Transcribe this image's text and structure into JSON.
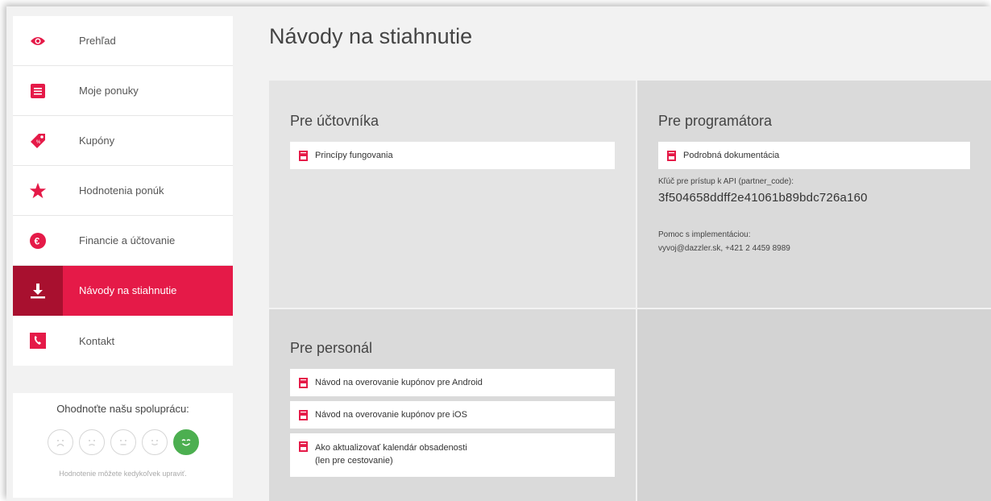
{
  "sidebar": {
    "items": [
      {
        "label": "Prehľad",
        "icon": "eye-icon"
      },
      {
        "label": "Moje ponuky",
        "icon": "list-icon"
      },
      {
        "label": "Kupóny",
        "icon": "tag-icon"
      },
      {
        "label": "Hodnotenia ponúk",
        "icon": "star-icon"
      },
      {
        "label": "Financie a účtovanie",
        "icon": "euro-icon"
      },
      {
        "label": "Návody na stiahnutie",
        "icon": "download-icon",
        "active": true
      },
      {
        "label": "Kontakt",
        "icon": "phone-book-icon"
      }
    ],
    "rating": {
      "title": "Ohodnoťte našu spoluprácu:",
      "note": "Hodnotenie môžete kedykoľvek upraviť.",
      "selected_face": 5
    }
  },
  "page": {
    "title": "Návody na stiahnutie"
  },
  "sections": {
    "accountant": {
      "title": "Pre účtovníka",
      "links": [
        "Princípy fungovania"
      ]
    },
    "programmer": {
      "title": "Pre programátora",
      "links": [
        "Podrobná dokumentácia"
      ],
      "api_label": "Kľúč pre prístup k API (partner_code):",
      "api_key": "3f504658ddff2e41061b89bdc726a160",
      "help_label": "Pomoc s implementáciou:",
      "help_contact": "vyvoj@dazzler.sk, +421 2 4459 8989"
    },
    "staff": {
      "title": "Pre personál",
      "links": [
        "Návod na overovanie kupónov pre Android",
        "Návod na overovanie kupónov pre iOS"
      ],
      "calendar_line1": "Ako aktualizovať kalendár obsadenosti",
      "calendar_line2": "(len pre cestovanie)"
    }
  },
  "colors": {
    "accent": "#e51a48",
    "accent_dark": "#a8102f",
    "positive": "#4caf50"
  }
}
